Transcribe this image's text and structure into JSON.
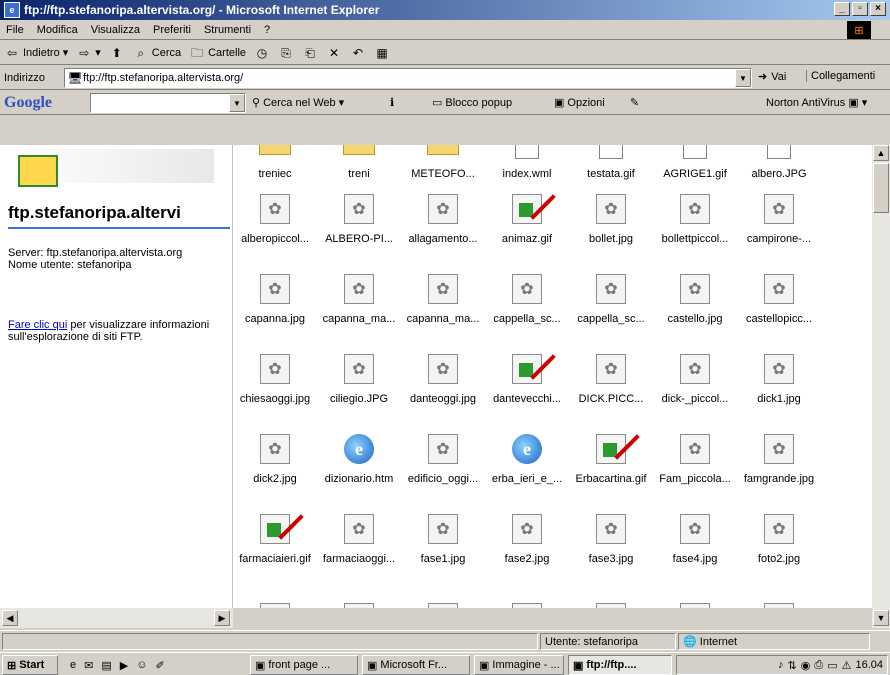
{
  "window": {
    "title": "ftp://ftp.stefanoripa.altervista.org/ - Microsoft Internet Explorer"
  },
  "menu": [
    "File",
    "Modifica",
    "Visualizza",
    "Preferiti",
    "Strumenti",
    "?"
  ],
  "toolbar": {
    "back": "Indietro",
    "search": "Cerca",
    "folders": "Cartelle"
  },
  "address": {
    "label": "Indirizzo",
    "value": "ftp://ftp.stefanoripa.altervista.org/",
    "go": "Vai",
    "links": "Collegamenti"
  },
  "googlebar": {
    "logo": "Google",
    "search_web": "Cerca nel Web",
    "popup": "Blocco popup",
    "options": "Opzioni",
    "norton": "Norton AntiVirus"
  },
  "leftpane": {
    "site_title": "ftp.stefanoripa.altervi",
    "server_line": "Server: ftp.stefanoripa.altervista.org",
    "user_line": "Nome utente: stefanoripa",
    "info_link": "Fare clic qui",
    "info_text": "per visualizzare informazioni sull'esplorazione di siti FTP."
  },
  "files": [
    {
      "name": "treniec",
      "type": "folder"
    },
    {
      "name": "treni",
      "type": "folder"
    },
    {
      "name": "METEOFO...",
      "type": "folder"
    },
    {
      "name": "index.wml",
      "type": "file"
    },
    {
      "name": "testata.gif",
      "type": "file"
    },
    {
      "name": "AGRIGE1.gif",
      "type": "file"
    },
    {
      "name": "albero.JPG",
      "type": "file"
    },
    {
      "name": "alberopiccol...",
      "type": "img"
    },
    {
      "name": "ALBERO-PI...",
      "type": "img"
    },
    {
      "name": "allagamento...",
      "type": "img"
    },
    {
      "name": "animaz.gif",
      "type": "gif"
    },
    {
      "name": "bollet.jpg",
      "type": "img"
    },
    {
      "name": "bollettpiccol...",
      "type": "img"
    },
    {
      "name": "campirone-...",
      "type": "img"
    },
    {
      "name": "capanna.jpg",
      "type": "img"
    },
    {
      "name": "capanna_ma...",
      "type": "img"
    },
    {
      "name": "capanna_ma...",
      "type": "img"
    },
    {
      "name": "cappella_sc...",
      "type": "img"
    },
    {
      "name": "cappella_sc...",
      "type": "img"
    },
    {
      "name": "castello.jpg",
      "type": "img"
    },
    {
      "name": "castellopicc...",
      "type": "img"
    },
    {
      "name": "chiesaoggi.jpg",
      "type": "img"
    },
    {
      "name": "ciliegio.JPG",
      "type": "img"
    },
    {
      "name": "danteoggi.jpg",
      "type": "img"
    },
    {
      "name": "dantevecchi...",
      "type": "gif"
    },
    {
      "name": "DICK.PICC...",
      "type": "img"
    },
    {
      "name": "dick-_piccol...",
      "type": "img"
    },
    {
      "name": "dick1.jpg",
      "type": "img"
    },
    {
      "name": "dick2.jpg",
      "type": "img"
    },
    {
      "name": "dizionario.htm",
      "type": "ie"
    },
    {
      "name": "edificio_oggi...",
      "type": "img"
    },
    {
      "name": "erba_ieri_e_...",
      "type": "ie"
    },
    {
      "name": "Erbacartina.gif",
      "type": "gif"
    },
    {
      "name": "Fam_piccola...",
      "type": "img"
    },
    {
      "name": "famgrande.jpg",
      "type": "img"
    },
    {
      "name": "farmaciaieri.gif",
      "type": "gif"
    },
    {
      "name": "farmaciaoggi...",
      "type": "img"
    },
    {
      "name": "fase1.jpg",
      "type": "img"
    },
    {
      "name": "fase2.jpg",
      "type": "img"
    },
    {
      "name": "fase3.jpg",
      "type": "img"
    },
    {
      "name": "fase4.jpg",
      "type": "img"
    },
    {
      "name": "foto2.jpg",
      "type": "img"
    }
  ],
  "status": {
    "user": "Utente: stefanoripa",
    "zone": "Internet"
  },
  "taskbar": {
    "start": "Start",
    "tasks": [
      "front page ...",
      "Microsoft Fr...",
      "Immagine - ...",
      "ftp://ftp...."
    ],
    "clock": "16.04"
  }
}
